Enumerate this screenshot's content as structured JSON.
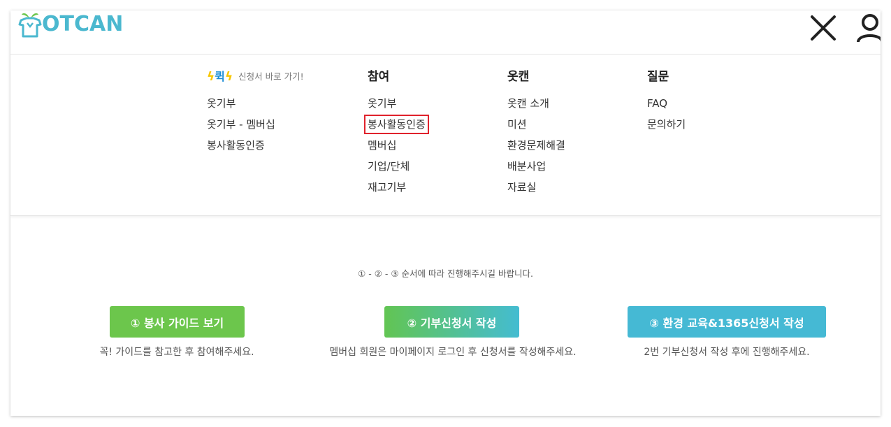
{
  "header": {
    "logo_text": "OTCAN",
    "close_icon": "close-icon",
    "user_icon": "user-icon"
  },
  "menu": {
    "quick": {
      "badge": "퀵",
      "subtitle": "신청서 바로 가기!",
      "items": [
        "옷기부",
        "옷기부 - 멤버십",
        "봉사활동인증"
      ]
    },
    "participate": {
      "title": "참여",
      "items": [
        "옷기부",
        "봉사활동인증",
        "멤버십",
        "기업/단체",
        "재고기부"
      ]
    },
    "otcan": {
      "title": "옷캔",
      "items": [
        "옷캔 소개",
        "미션",
        "환경문제해결",
        "배분사업",
        "자료실"
      ]
    },
    "qna": {
      "title": "질문",
      "items": [
        "FAQ",
        "문의하기"
      ]
    }
  },
  "content": {
    "notice": "① - ② - ③ 순서에 따라 진행해주시길 바랍니다.",
    "steps": [
      {
        "label": "① 봉사 가이드 보기",
        "desc": "꼭! 가이드를 참고한 후 참여해주세요."
      },
      {
        "label": "② 기부신청서 작성",
        "desc": "멤버십 회원은 마이페이지 로그인 후 신청서를 작성해주세요."
      },
      {
        "label": "③ 환경 교육&1365신청서 작성",
        "desc": "2번 기부신청서 작성 후에 진행해주세요."
      }
    ]
  },
  "colors": {
    "brand": "#4bb8cf",
    "green": "#6cc64c",
    "blue": "#45b9d4",
    "highlight_border": "#e0222c"
  }
}
